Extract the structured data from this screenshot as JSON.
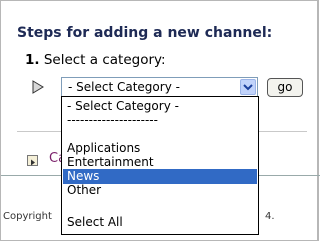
{
  "heading": "Steps for adding a new channel:",
  "step1": {
    "number": "1.",
    "label": "Select a category:"
  },
  "select": {
    "value": "- Select Category -"
  },
  "go_button": "go",
  "link_partial": "Ca",
  "footer": {
    "copyright_start": "Copyright",
    "copyright_end": "4."
  },
  "dropdown": {
    "options": [
      "- Select Category -",
      "---------------------",
      "",
      "Applications",
      "Entertainment",
      "News",
      "Other",
      "",
      "Select All"
    ],
    "selected": "News"
  },
  "colors": {
    "selection": "#316ac5",
    "heading": "#1e2a55",
    "link": "#7a1f6a"
  }
}
